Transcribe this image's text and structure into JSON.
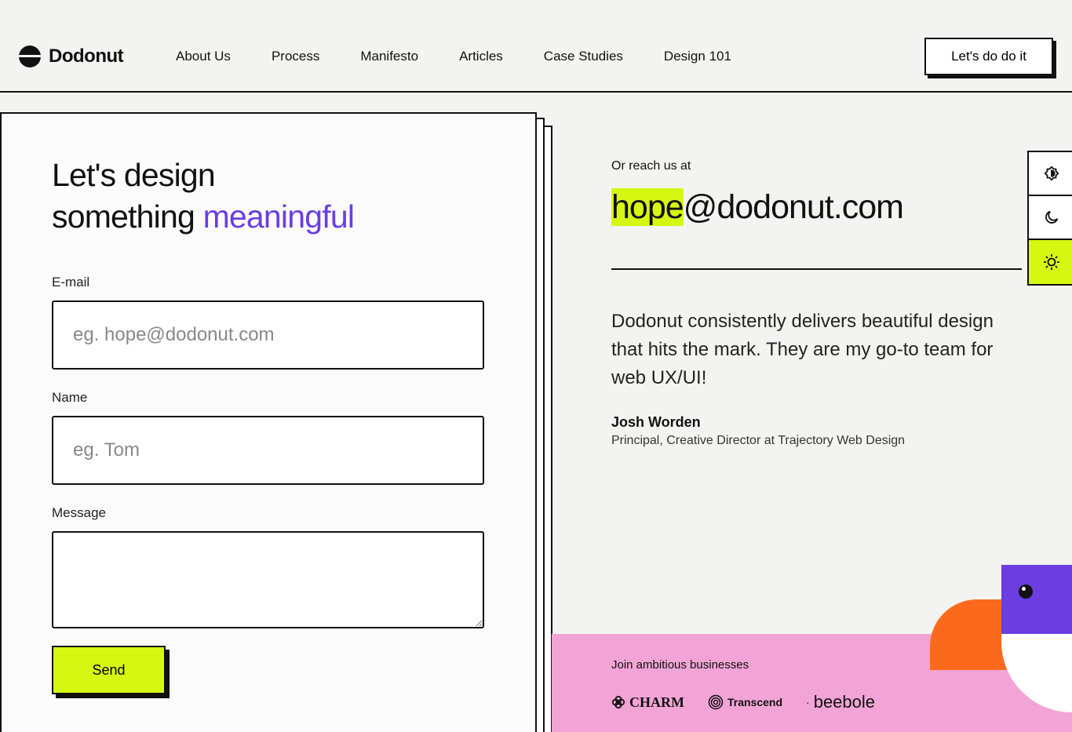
{
  "header": {
    "logo": "Dodonut",
    "nav": [
      "About Us",
      "Process",
      "Manifesto",
      "Articles",
      "Case Studies",
      "Design 101"
    ],
    "cta_label": "Let's do do it"
  },
  "form": {
    "heading_line1": "Let's design",
    "heading_line2": "something",
    "heading_accent": "meaningful",
    "email_label": "E-mail",
    "email_placeholder": "eg. hope@dodonut.com",
    "name_label": "Name",
    "name_placeholder": "eg. Tom",
    "message_label": "Message",
    "send_label": "Send"
  },
  "contact": {
    "reach_label": "Or reach us at",
    "email_highlight": "hope",
    "email_rest": "@dodonut.com",
    "quote": "Dodonut consistently delivers beautiful design that hits the mark. They are my go-to team for web UX/UI!",
    "author": "Josh Worden",
    "author_role": "Principal, Creative Director at Trajectory Web Design"
  },
  "theme_switcher": {
    "icons": [
      "contrast-icon",
      "moon-icon",
      "sun-icon"
    ],
    "active": "sun-icon"
  },
  "banner": {
    "title": "Join ambitious businesses",
    "brands": [
      "CHARM",
      "Transcend",
      "beebole"
    ]
  },
  "colors": {
    "accent_lime": "#d6f712",
    "accent_purple": "#6a3ee0",
    "accent_orange": "#fb6a1c",
    "banner_pink": "#f2a4d6"
  }
}
